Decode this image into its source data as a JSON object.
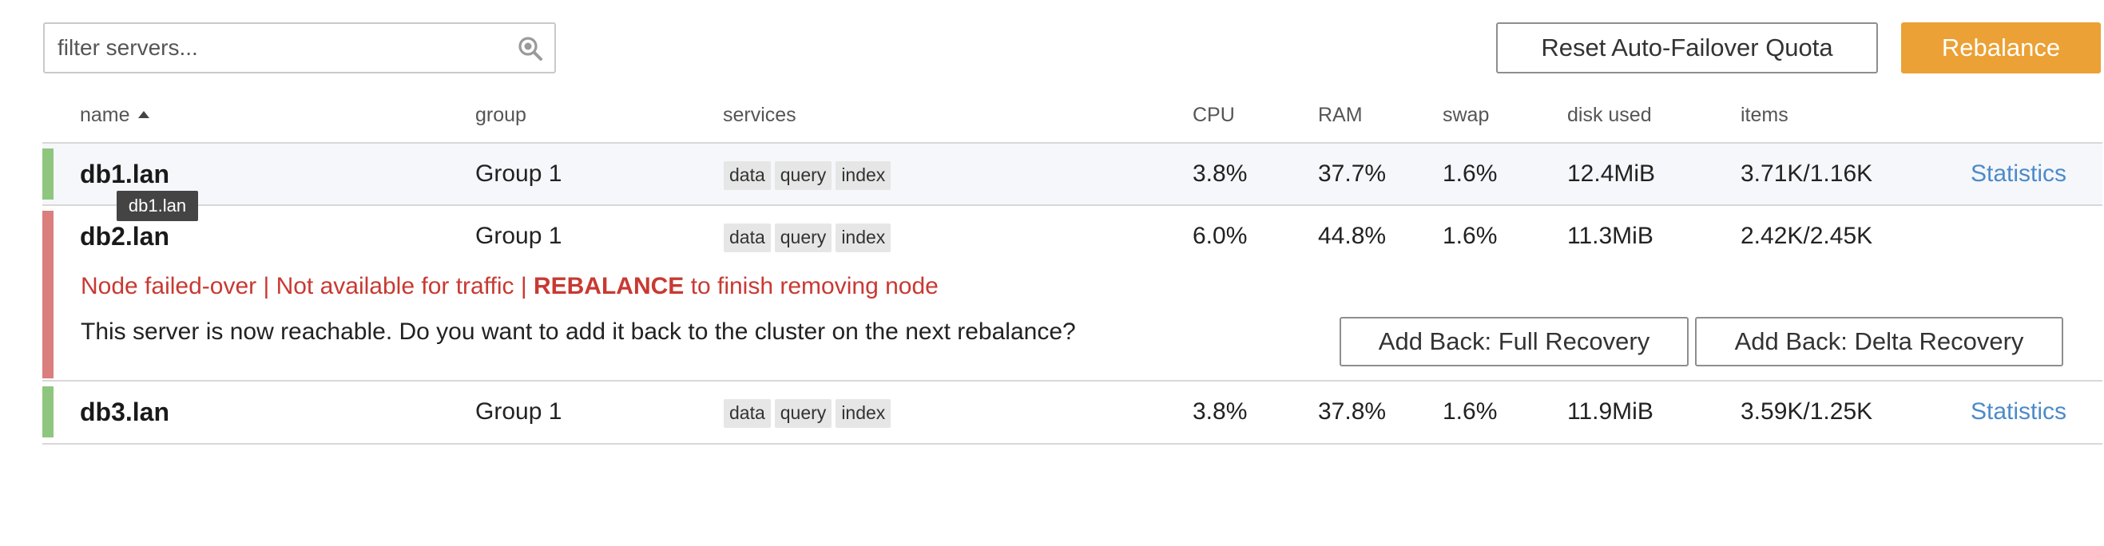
{
  "search": {
    "placeholder": "filter servers..."
  },
  "toolbar": {
    "reset_label": "Reset Auto-Failover Quota",
    "rebalance_label": "Rebalance"
  },
  "columns": {
    "name": "name",
    "group": "group",
    "services": "services",
    "cpu": "CPU",
    "ram": "RAM",
    "swap": "swap",
    "disk": "disk used",
    "items": "items"
  },
  "sort": {
    "column": "name",
    "direction": "ascending"
  },
  "servers": [
    {
      "name": "db1.lan",
      "group": "Group 1",
      "services": [
        "data",
        "query",
        "index"
      ],
      "cpu": "3.8%",
      "ram": "37.7%",
      "swap": "1.6%",
      "disk": "12.4MiB",
      "items": "3.71K/1.16K",
      "link": "Statistics",
      "status": "healthy"
    },
    {
      "name": "db2.lan",
      "group": "Group 1",
      "services": [
        "data",
        "query",
        "index"
      ],
      "cpu": "6.0%",
      "ram": "44.8%",
      "swap": "1.6%",
      "disk": "11.3MiB",
      "items": "2.42K/2.45K",
      "status": "failed-over",
      "failover_message": {
        "prefix": "Node failed-over | Not available for traffic | ",
        "emphasis": "REBALANCE",
        "suffix": " to finish removing node"
      },
      "reachable_message": "This server is now reachable. Do you want to add it back to the cluster on the next rebalance?",
      "full_recovery_label": "Add Back: Full Recovery",
      "delta_recovery_label": "Add Back: Delta Recovery"
    },
    {
      "name": "db3.lan",
      "group": "Group 1",
      "services": [
        "data",
        "query",
        "index"
      ],
      "cpu": "3.8%",
      "ram": "37.8%",
      "swap": "1.6%",
      "disk": "11.9MiB",
      "items": "3.59K/1.25K",
      "link": "Statistics",
      "status": "healthy"
    }
  ],
  "tooltip": {
    "text": "db1.lan"
  },
  "colors": {
    "accent": "#eba135",
    "link": "#4d8ac9",
    "status_ok": "#8fc67f",
    "status_fail": "#da7f7d",
    "error_text": "#c83932"
  },
  "icons": {
    "search": "search-icon"
  }
}
